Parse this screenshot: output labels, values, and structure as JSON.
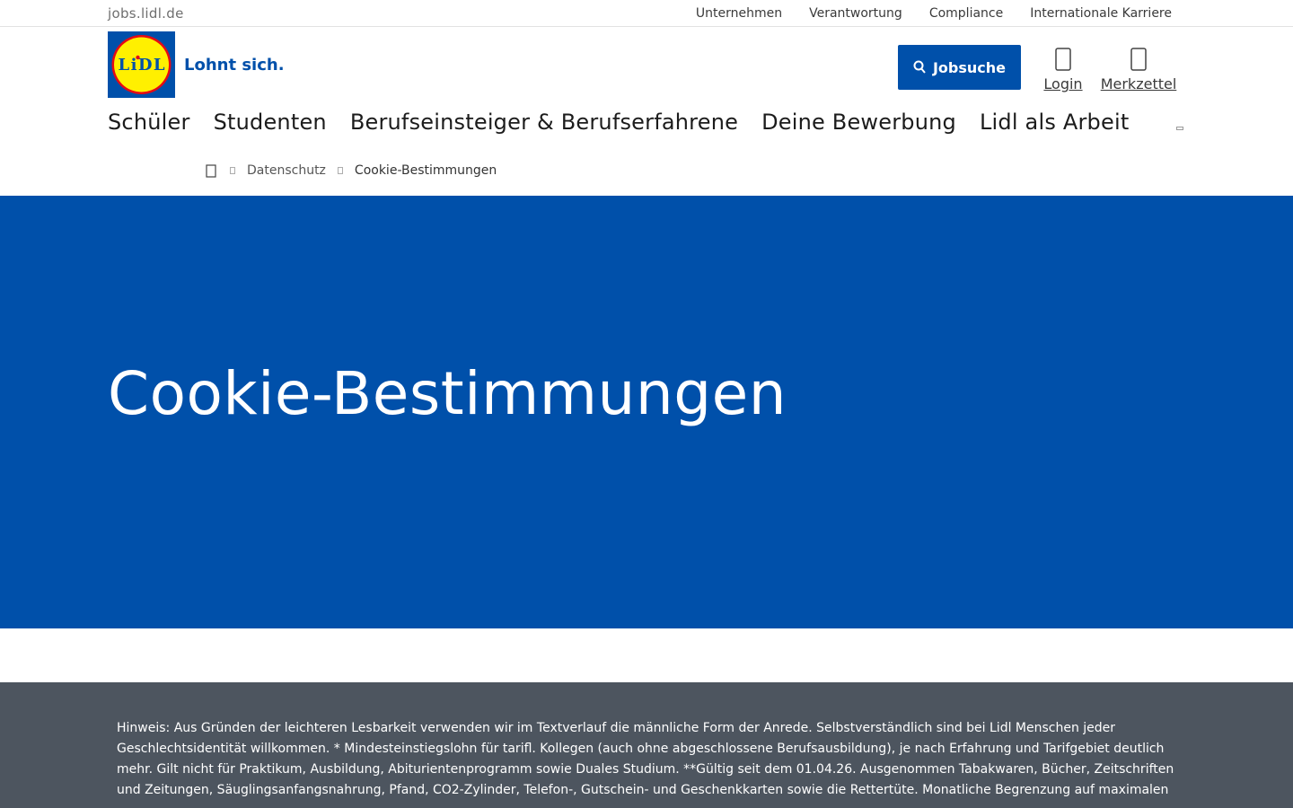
{
  "topbar": {
    "domain": "jobs.lidl.de",
    "links": [
      "Unternehmen",
      "Verantwortung",
      "Compliance",
      "Internationale Karriere"
    ]
  },
  "header": {
    "logo_text": "LiDL",
    "slogan": "Lohnt sich.",
    "jobsearch_label": "Jobsuche",
    "login_label": "Login",
    "merkzettel_label": "Merkzettel"
  },
  "nav": {
    "items": [
      "Schüler",
      "Studenten",
      "Berufseinsteiger & Berufserfahrene",
      "Deine Bewerbung",
      "Lidl als Arbeit"
    ]
  },
  "breadcrumb": {
    "items": [
      "Datenschutz",
      "Cookie-Bestimmungen"
    ]
  },
  "hero": {
    "title": "Cookie-Bestimmungen"
  },
  "note": {
    "text": "Hinweis: Aus Gründen der leichteren Lesbarkeit verwenden wir im Textverlauf die männliche Form der Anrede. Selbstverständlich sind bei Lidl Menschen jeder Geschlechtsidentität willkommen. * Mindesteinstiegslohn für tarifl. Kollegen (auch ohne abgeschlossene Berufsausbildung), je nach Erfahrung und Tarifgebiet deutlich mehr. Gilt nicht für Praktikum, Ausbildung, Abiturientenprogramm sowie Duales Studium. **Gültig seit dem 01.04.26. Ausgenommen Tabakwaren, Bücher, Zeitschriften und Zeitungen, Säuglingsanfangsnahrung, Pfand, CO2-Zylinder, Telefon-, Gutschein- und Geschenkkarten sowie die Rettertüte. Monatliche Begrenzung auf maximalen"
  },
  "colors": {
    "brand_blue": "#0050aa",
    "logo_yellow": "#fff000",
    "logo_red": "#e60a14",
    "note_bg": "#4d555f"
  },
  "icons": {
    "jobsearch": "search-icon",
    "login": "user-icon",
    "merkzettel": "heart-icon",
    "breadcrumb_home": "home-icon",
    "breadcrumb_separator": "chevron-right-icon"
  }
}
